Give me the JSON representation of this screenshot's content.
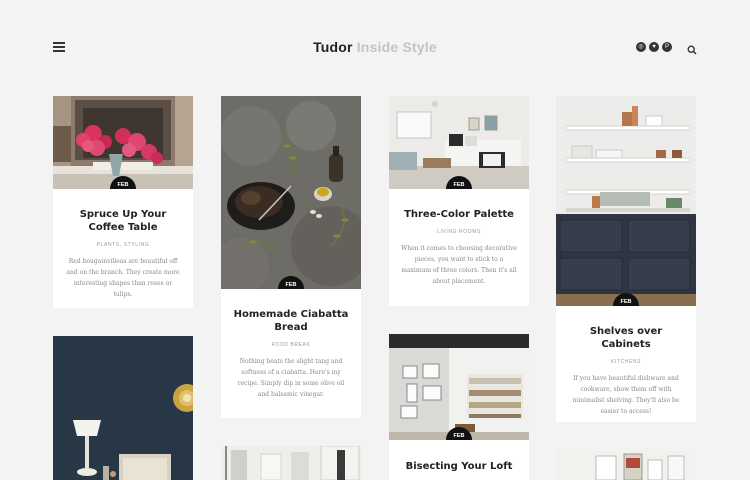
{
  "header": {
    "brand_primary": "Tudor",
    "brand_secondary": "Inside Style",
    "social": [
      {
        "icon": "instagram-icon",
        "glyph": "◎"
      },
      {
        "icon": "twitter-icon",
        "glyph": "♥"
      },
      {
        "icon": "pinterest-icon",
        "glyph": "P"
      }
    ]
  },
  "posts": [
    {
      "month": "FEB",
      "day": "12",
      "title": "Spruce Up Your Coffee Table",
      "categories": "PLANTS, STYLING",
      "excerpt": "Red bougainvilleas are beautiful off and on the branch. They create more interesting shapes than roses or tulips."
    },
    {
      "month": "FEB",
      "day": "11",
      "title": "Homemade Ciabatta Bread",
      "categories": "FOOD BREAK",
      "excerpt": "Nothing beats the slight tang and softness of a ciabatta. Here's my recipe. Simply dip in some olive oil and balsamic vinegar."
    },
    {
      "month": "FEB",
      "day": "10",
      "title": "Three-Color Palette",
      "categories": "LIVING ROOMS",
      "excerpt": "When it comes to choosing decorative pieces, you want to stick to a maximum of three colors. Then it's all about placement."
    },
    {
      "month": "FEB",
      "day": "10",
      "title": "Shelves over Cabinets",
      "categories": "KITCHENS",
      "excerpt": "If you have beautiful dishware and cookware, show them off with minimalist shelving. They'll also be easier to access!"
    },
    {
      "month": "FEB",
      "day": "9",
      "title": "Bisecting Your Loft"
    }
  ],
  "colors": {
    "background": "#f3f3f3",
    "card": "#ffffff",
    "date_badge": "#111111",
    "brand_secondary": "#c4c4c4"
  }
}
